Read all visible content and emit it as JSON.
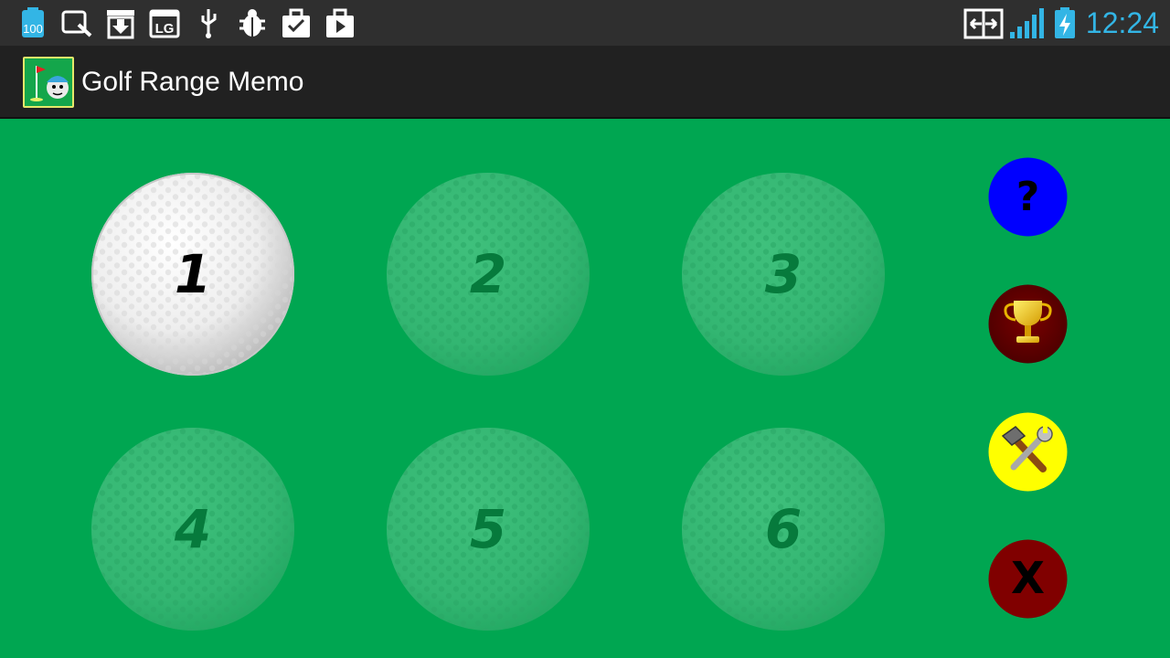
{
  "status_bar": {
    "battery_level": "100",
    "lg_label": "LG",
    "time": "12:24",
    "icons": [
      "battery-icon",
      "search-icon",
      "download-icon",
      "lg-icon",
      "usb-icon",
      "debug-icon",
      "task-icon",
      "play-store-icon",
      "screen-share-icon",
      "signal-icon",
      "battery-charging-icon"
    ],
    "accent_color": "#33b5e5"
  },
  "action_bar": {
    "title": "Golf Range Memo",
    "icon": "golf-app-icon"
  },
  "balls": [
    {
      "label": "1",
      "state": "active"
    },
    {
      "label": "2",
      "state": "inactive"
    },
    {
      "label": "3",
      "state": "inactive"
    },
    {
      "label": "4",
      "state": "inactive"
    },
    {
      "label": "5",
      "state": "inactive"
    },
    {
      "label": "6",
      "state": "inactive"
    }
  ],
  "side_buttons": {
    "help": {
      "label": "?",
      "color": "#0000ff",
      "icon": "help-icon"
    },
    "trophy": {
      "color": "#660000",
      "icon": "trophy-icon"
    },
    "settings": {
      "color": "#ffff00",
      "icon": "tools-icon"
    },
    "exit": {
      "label": "X",
      "color": "#800000",
      "icon": "close-icon"
    }
  },
  "colors": {
    "background": "#00a651",
    "action_bar": "#212121",
    "status_bar": "#2f2f2f"
  }
}
